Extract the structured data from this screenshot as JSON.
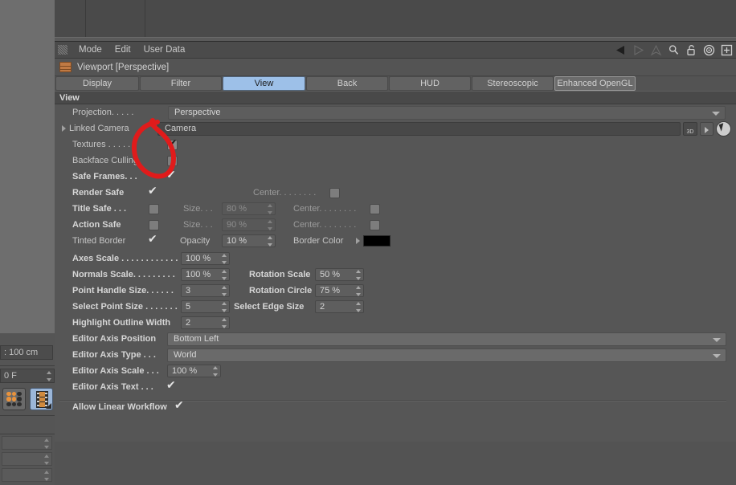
{
  "app": {
    "panel_title": "Viewport [Perspective]",
    "menu": [
      "Mode",
      "Edit",
      "User Data"
    ],
    "header_icons": [
      "back-arrow-icon",
      "forward-arrow-icon",
      "up-arrow-icon",
      "search-icon",
      "lock-icon",
      "target-icon",
      "add-icon"
    ]
  },
  "tabs": [
    {
      "label": "Display",
      "active": false
    },
    {
      "label": "Filter",
      "active": false
    },
    {
      "label": "View",
      "active": true
    },
    {
      "label": "Back",
      "active": false
    },
    {
      "label": "HUD",
      "active": false
    },
    {
      "label": "Stereoscopic",
      "active": false
    },
    {
      "label": "Enhanced OpenGL",
      "active": false
    }
  ],
  "section": {
    "title": "View"
  },
  "left_panel": {
    "measure_value": ": 100 cm",
    "frame_value": "0 F",
    "buttons": [
      "dots-grid-icon",
      "filmstrip-icon"
    ]
  },
  "view_settings": {
    "projection": {
      "label": "Projection. . . . .",
      "value": "Perspective"
    },
    "linked_camera": {
      "label": "Linked Camera",
      "value": "Camera",
      "link_badge": "3D"
    },
    "textures": {
      "label": "Textures . . . . . .",
      "checked": true
    },
    "backface_culling": {
      "label": "Backface Culling",
      "checked": false
    },
    "safe_frames": {
      "label": "Safe Frames. . .",
      "checked": true
    },
    "render_safe": {
      "label": "Render Safe",
      "checked": true,
      "center_label": "Center. . . . . . . .",
      "center_checked": false
    },
    "title_safe": {
      "label": "Title Safe . . .",
      "checked": false,
      "size_label": "Size. . .",
      "size_value": "80 %",
      "center_label": "Center. . . . . . . .",
      "center_checked": false
    },
    "action_safe": {
      "label": "Action Safe",
      "checked": false,
      "size_label": "Size. . .",
      "size_value": "90 %",
      "center_label": "Center. . . . . . . .",
      "center_checked": false
    },
    "tinted_border": {
      "label": "Tinted Border",
      "checked": true,
      "opacity_label": "Opacity",
      "opacity_value": "10 %",
      "border_color_label": "Border Color",
      "border_color": "#000000"
    },
    "axes_scale": {
      "label": "Axes Scale . . . . . . . . . . . .",
      "value": "100 %"
    },
    "normals_scale": {
      "label": "Normals Scale. . . . . . . . .",
      "value": "100 %"
    },
    "point_handle_size": {
      "label": "Point Handle Size. . . . . .",
      "value": "3"
    },
    "select_point_size": {
      "label": "Select Point Size . . . . . . .",
      "value": "5"
    },
    "highlight_outline_width": {
      "label": "Highlight Outline Width",
      "value": "2"
    },
    "rotation_scale": {
      "label": "Rotation Scale",
      "value": "50 %"
    },
    "rotation_circle": {
      "label": "Rotation Circle",
      "value": "75 %"
    },
    "select_edge_size": {
      "label": "Select Edge Size",
      "value": "2"
    },
    "editor_axis_position": {
      "label": "Editor Axis Position",
      "value": "Bottom Left"
    },
    "editor_axis_type": {
      "label": "Editor Axis Type . . .",
      "value": "World"
    },
    "editor_axis_scale": {
      "label": "Editor Axis Scale . . .",
      "value": "100 %"
    },
    "editor_axis_text": {
      "label": "Editor Axis Text . . .",
      "checked": true
    },
    "allow_linear_workflow": {
      "label": "Allow Linear Workflow",
      "checked": true
    }
  },
  "annotation": {
    "color": "#e01b1b",
    "shape": "hand-drawn-circle"
  }
}
